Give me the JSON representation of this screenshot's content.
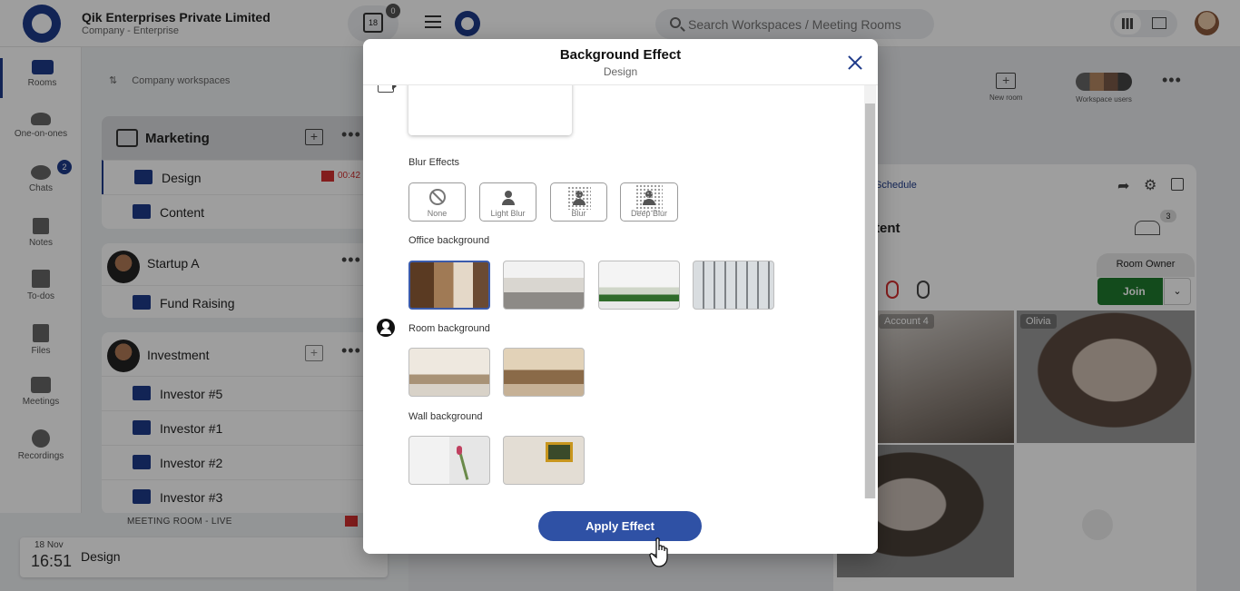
{
  "topbar": {
    "company": "Qik Enterprises Private Limited",
    "company_sub": "Company - Enterprise",
    "calendar_day": "18",
    "calendar_badge": "0",
    "search_placeholder": "Search Workspaces / Meeting Rooms"
  },
  "rail": {
    "items": [
      {
        "label": "Rooms",
        "icon": "rooms-icon"
      },
      {
        "label": "One-on-ones",
        "icon": "people-icon"
      },
      {
        "label": "Chats",
        "icon": "chat-icon",
        "badge": "2"
      },
      {
        "label": "Notes",
        "icon": "notes-icon"
      },
      {
        "label": "To-dos",
        "icon": "checkbox-icon"
      },
      {
        "label": "Files",
        "icon": "files-icon"
      },
      {
        "label": "Meetings",
        "icon": "meetings-icon"
      },
      {
        "label": "Recordings",
        "icon": "recordings-icon"
      }
    ]
  },
  "workspaces": {
    "header": "Company workspaces",
    "marketing": {
      "title": "Marketing",
      "rooms": [
        {
          "label": "Design",
          "timer": "00:42"
        },
        {
          "label": "Content"
        }
      ]
    },
    "startup": {
      "title": "Startup A",
      "rooms": [
        {
          "label": "Fund Raising"
        }
      ]
    },
    "investment": {
      "title": "Investment",
      "rooms": [
        {
          "label": "Investor #5"
        },
        {
          "label": "Investor #1"
        },
        {
          "label": "Investor #2"
        },
        {
          "label": "Investor #3"
        }
      ]
    }
  },
  "live": {
    "label": "MEETING ROOM - LIVE",
    "date": "18 Nov",
    "time": "16:51",
    "room": "Design"
  },
  "right": {
    "new_room": "New room",
    "workspace_users": "Workspace users",
    "schedule": "Schedule",
    "room_title": "tent",
    "participants_count": "3",
    "room_owner": "Room Owner",
    "join": "Join",
    "tiles": [
      {
        "name": "Account 4"
      },
      {
        "name": "Olivia"
      }
    ]
  },
  "modal": {
    "title": "Background Effect",
    "subtitle": "Design",
    "sections": {
      "blur": "Blur Effects",
      "office": "Office background",
      "room": "Room background",
      "wall": "Wall background"
    },
    "blur_options": [
      "None",
      "Light Blur",
      "Blur",
      "Deep Blur"
    ],
    "apply": "Apply Effect"
  },
  "colors": {
    "brand": "#1e3a8a",
    "apply": "#2f51a5",
    "join": "#1f7a2e",
    "live_red": "#d32f2f"
  }
}
